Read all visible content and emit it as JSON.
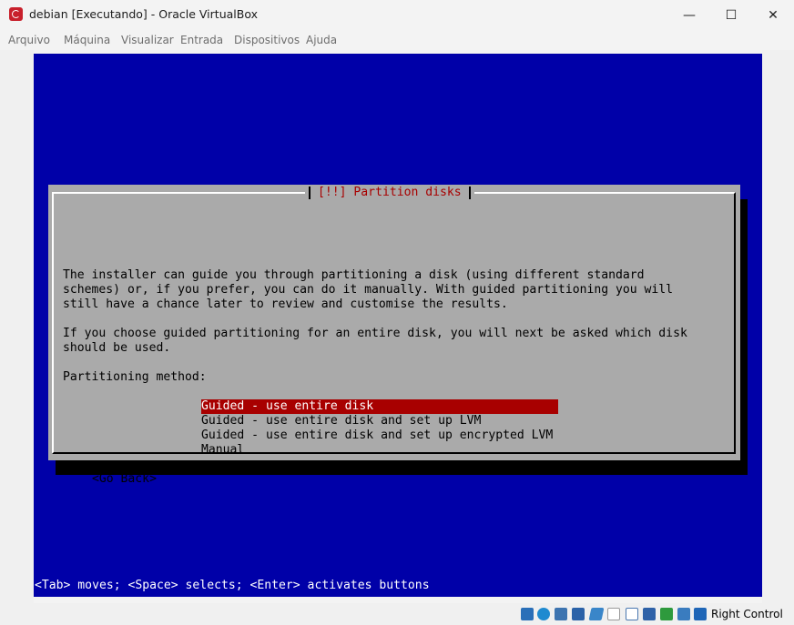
{
  "window": {
    "title": "debian [Executando] - Oracle VirtualBox",
    "minimize": "—",
    "maximize": "☐",
    "close": "✕"
  },
  "menu": [
    "Arquivo",
    "Máquina",
    "Visualizar",
    "Entrada",
    "Dispositivos",
    "Ajuda"
  ],
  "dialog": {
    "title": "[!!] Partition disks",
    "paragraph1": [
      "The installer can guide you through partitioning a disk (using different standard",
      "schemes) or, if you prefer, you can do it manually. With guided partitioning you will",
      "still have a chance later to review and customise the results."
    ],
    "paragraph2": [
      "If you choose guided partitioning for an entire disk, you will next be asked which disk",
      "should be used."
    ],
    "method_label": "Partitioning method:",
    "options": [
      "Guided - use entire disk",
      "Guided - use entire disk and set up LVM",
      "Guided - use entire disk and set up encrypted LVM",
      "Manual"
    ],
    "selected_index": 0,
    "go_back": "<Go Back>"
  },
  "hint": "<Tab> moves; <Space> selects; <Enter> activates buttons",
  "statusbar": {
    "host_key": "Right Control",
    "icons": [
      "hard-disk-icon",
      "optical-drive-icon",
      "audio-icon",
      "network-icon",
      "usb-icon",
      "shared-folders-icon",
      "display-icon",
      "recording-icon",
      "cpu-icon",
      "mouse-integration-icon"
    ]
  },
  "colors": {
    "screen_bg": "#0000a8",
    "dialog_bg": "#aaaaaa",
    "accent_red": "#a80000"
  }
}
